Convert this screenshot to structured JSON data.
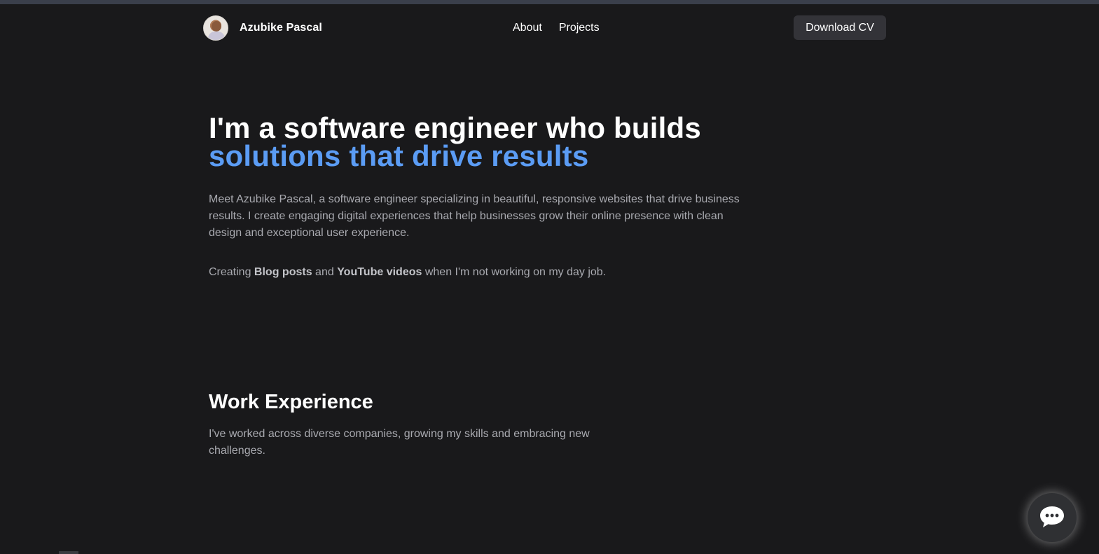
{
  "header": {
    "brand_name": "Azubike Pascal",
    "nav": [
      {
        "label": "About"
      },
      {
        "label": "Projects"
      }
    ],
    "download_label": "Download CV"
  },
  "hero": {
    "title_line1": "I'm a software engineer who builds",
    "title_line2": "solutions that drive results",
    "intro": "Meet Azubike Pascal, a software engineer specializing in beautiful, responsive websites that drive business results. I create engaging digital experiences that help businesses grow their online presence with clean design and exceptional user experience.",
    "side_prefix": "Creating ",
    "side_blog": "Blog posts",
    "side_and": " and ",
    "side_youtube": "YouTube videos",
    "side_suffix": " when I'm not working on my day job."
  },
  "work": {
    "title": "Work Experience",
    "description": "I've worked across diverse companies, growing my skills and embracing new challenges."
  },
  "icons": {
    "avatar": "profile-photo",
    "chat": "chat-bubble-icon"
  },
  "colors": {
    "background": "#19191b",
    "accent": "#5b9cf4",
    "muted_text": "#a9aab0",
    "button_bg": "#333338"
  }
}
